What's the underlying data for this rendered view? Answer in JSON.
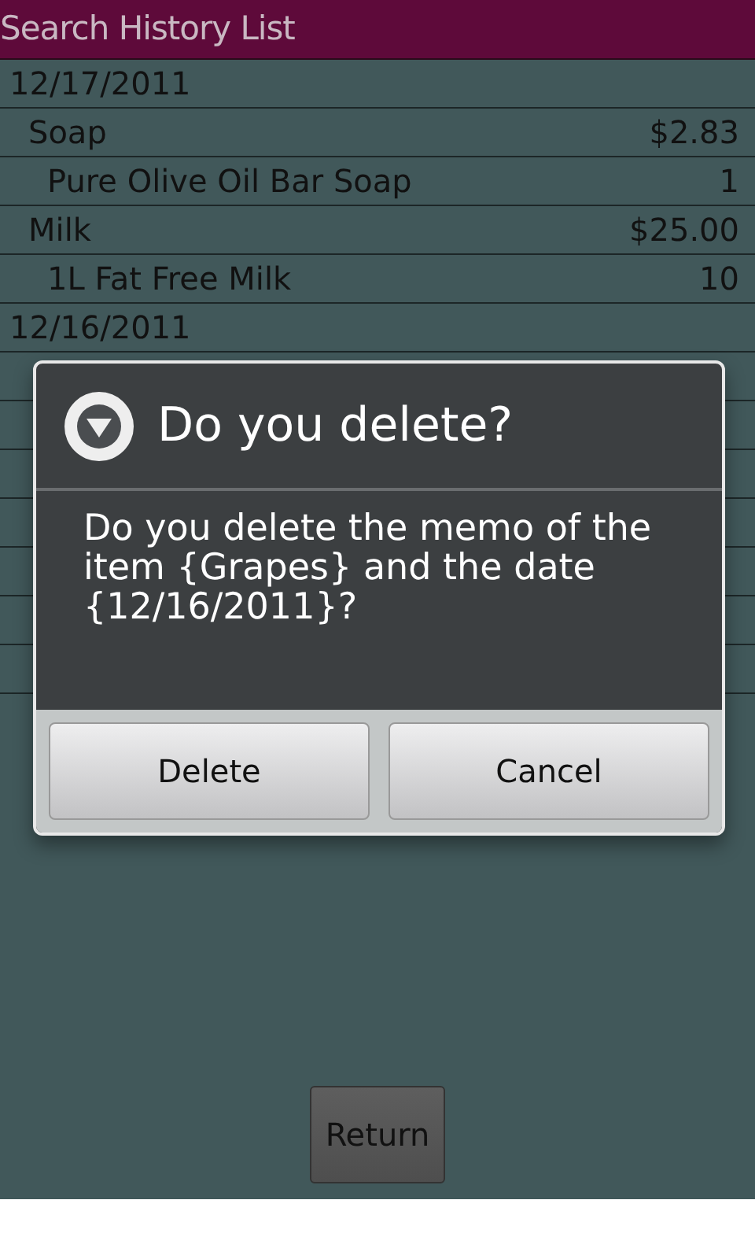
{
  "header": {
    "title": "Search History List"
  },
  "rows": [
    {
      "kind": "date",
      "label": "12/17/2011"
    },
    {
      "kind": "item",
      "label": "Soap",
      "value": "$2.83"
    },
    {
      "kind": "detail",
      "label": "Pure Olive Oil Bar Soap",
      "value": "1"
    },
    {
      "kind": "item",
      "label": "Milk",
      "value": "$25.00"
    },
    {
      "kind": "detail",
      "label": "1L Fat Free Milk",
      "value": "10"
    },
    {
      "kind": "date",
      "label": "12/16/2011"
    }
  ],
  "dialog": {
    "title": "Do you delete?",
    "message": "Do you delete the memo of the item {Grapes} and the date {12/16/2011}?",
    "buttons": [
      "Delete",
      "Cancel"
    ]
  },
  "return_button": "Return"
}
